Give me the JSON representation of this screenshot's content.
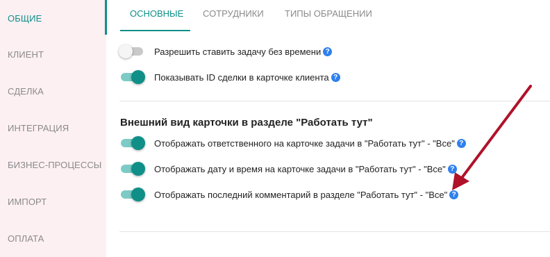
{
  "sidebar": {
    "items": [
      {
        "label": "ОБЩИЕ",
        "active": true
      },
      {
        "label": "КЛИЕНТ",
        "active": false
      },
      {
        "label": "СДЕЛКА",
        "active": false
      },
      {
        "label": "ИНТЕГРАЦИЯ",
        "active": false
      },
      {
        "label": "БИЗНЕС-ПРОЦЕССЫ",
        "active": false
      },
      {
        "label": "ИМПОРТ",
        "active": false
      },
      {
        "label": "ОПЛАТА",
        "active": false
      }
    ]
  },
  "tabs": [
    {
      "label": "ОСНОВНЫЕ",
      "active": true
    },
    {
      "label": "СОТРУДНИКИ",
      "active": false
    },
    {
      "label": "ТИПЫ ОБРАЩЕНИИ",
      "active": false
    }
  ],
  "settings": {
    "general": [
      {
        "label": "Разрешить ставить задачу без времени",
        "enabled": false,
        "help_icon": "question-icon"
      },
      {
        "label": "Показывать ID сделки в карточке клиента",
        "enabled": true,
        "help_icon": "question-icon"
      }
    ],
    "card_section_title": "Внешний вид карточки в разделе \"Работать тут\"",
    "card_view": [
      {
        "label": "Отображать ответственного на карточке задачи в \"Работать тут\" - \"Все\"",
        "enabled": true,
        "help_icon": "question-icon"
      },
      {
        "label": "Отображать дату и время на карточке задачи в \"Работать тут\" - \"Все\"",
        "enabled": true,
        "help_icon": "question-icon"
      },
      {
        "label": "Отображать последний комментарий в разделе \"Работать тут\" - \"Все\"",
        "enabled": true,
        "help_icon": "question-icon"
      }
    ]
  },
  "help_glyph": "?",
  "colors": {
    "accent": "#0f8f88",
    "sidebar_bg": "#fdf0f3",
    "help_icon": "#2f80ed",
    "annotation_arrow": "#b0122a"
  }
}
